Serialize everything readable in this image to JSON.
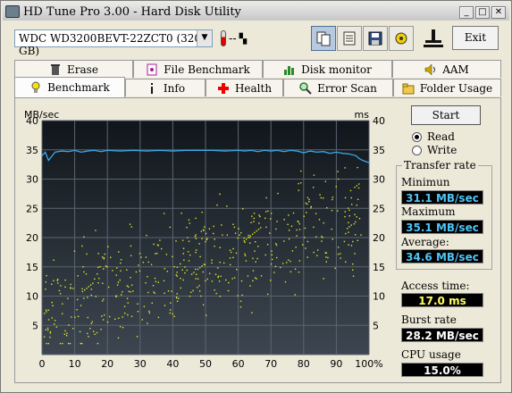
{
  "window": {
    "title": "HD Tune Pro 3.00 - Hard Disk Utility"
  },
  "toolbar": {
    "drive": "WDC WD3200BEVT-22ZCT0 (320 GB)",
    "temperature": "--",
    "exit_label": "Exit"
  },
  "tabs_top": [
    "Erase",
    "File Benchmark",
    "Disk monitor",
    "AAM"
  ],
  "tabs_bottom": [
    "Benchmark",
    "Info",
    "Health",
    "Error Scan",
    "Folder Usage"
  ],
  "controls": {
    "start_label": "Start",
    "read_label": "Read",
    "write_label": "Write",
    "mode": "Read"
  },
  "stats": {
    "transfer_rate_label": "Transfer rate",
    "minimum_label": "Minimun",
    "minimum_value": "31.1 MB/sec",
    "maximum_label": "Maximum",
    "maximum_value": "35.1 MB/sec",
    "average_label": "Average:",
    "average_value": "34.6 MB/sec",
    "access_label": "Access time:",
    "access_value": "17.0 ms",
    "burst_label": "Burst rate",
    "burst_value": "28.2 MB/sec",
    "cpu_label": "CPU usage",
    "cpu_value": "15.0%"
  },
  "chart_data": {
    "type": "line",
    "ylabel_left": "MB/sec",
    "ylabel_right": "ms",
    "x_ticks": [
      "0",
      "10",
      "20",
      "30",
      "40",
      "50",
      "60",
      "70",
      "80",
      "90",
      "100%"
    ],
    "y_ticks": [
      "5",
      "10",
      "15",
      "20",
      "25",
      "30",
      "35",
      "40"
    ],
    "xlim": [
      0,
      100
    ],
    "ylim": [
      0,
      40
    ],
    "grid": true,
    "series": [
      {
        "kind": "transfer_rate_MBps",
        "color": "#3aa7e6",
        "x": [
          0,
          1,
          2,
          4,
          6,
          8,
          10,
          12,
          14,
          16,
          18,
          20,
          24,
          28,
          32,
          36,
          40,
          44,
          48,
          52,
          56,
          60,
          62,
          64,
          66,
          68,
          70,
          72,
          74,
          76,
          78,
          80,
          82,
          84,
          86,
          88,
          90,
          92,
          94,
          96,
          97,
          98,
          99,
          100
        ],
        "y": [
          34.0,
          34.6,
          33.2,
          34.6,
          34.8,
          34.7,
          34.9,
          34.6,
          34.8,
          34.9,
          34.7,
          34.9,
          34.8,
          34.9,
          34.8,
          34.9,
          34.8,
          34.9,
          34.9,
          34.9,
          34.8,
          34.9,
          34.8,
          34.9,
          34.7,
          34.9,
          34.8,
          34.9,
          34.7,
          34.9,
          34.8,
          34.5,
          34.8,
          34.6,
          34.7,
          34.4,
          34.6,
          34.4,
          34.3,
          34.0,
          33.5,
          33.2,
          33.0,
          32.8
        ]
      },
      {
        "kind": "access_time_ms",
        "color": "#e6e62a",
        "summary": "scatter of random access times mostly between 5 and 30 ms, increasing with disk position"
      }
    ]
  }
}
